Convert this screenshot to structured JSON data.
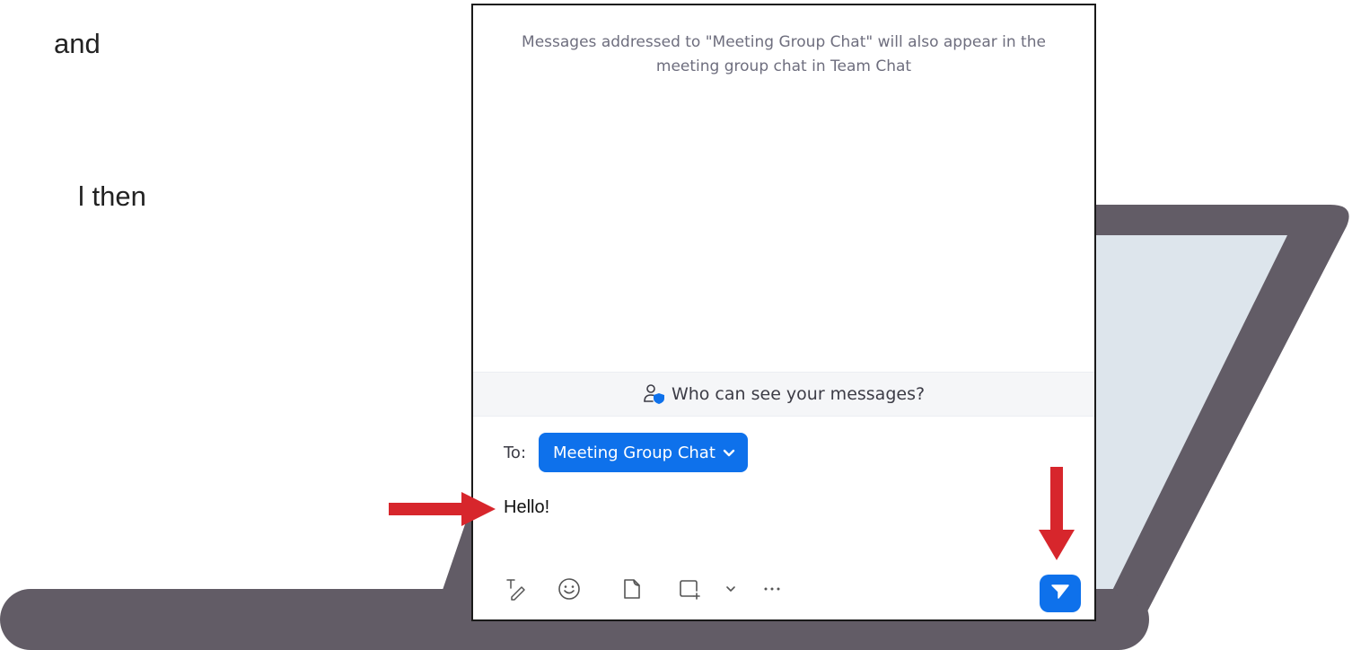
{
  "background_text": {
    "line1": "and",
    "line2": "l then"
  },
  "chat": {
    "notice": "Messages addressed to \"Meeting Group Chat\" will also appear in the meeting group chat in Team Chat",
    "privacy_link": "Who can see your messages?",
    "to_label": "To:",
    "recipient": "Meeting Group Chat",
    "message": "Hello!"
  },
  "toolbar": {
    "icons": [
      "format-text-icon",
      "emoji-icon",
      "file-icon",
      "screenshot-icon",
      "chevron-down-icon",
      "more-icon",
      "send-icon"
    ]
  },
  "colors": {
    "accent": "#0e71eb",
    "annotation_arrow": "#d7262c",
    "laptop_frame": "#625c66",
    "laptop_screen": "#dde5ec"
  }
}
